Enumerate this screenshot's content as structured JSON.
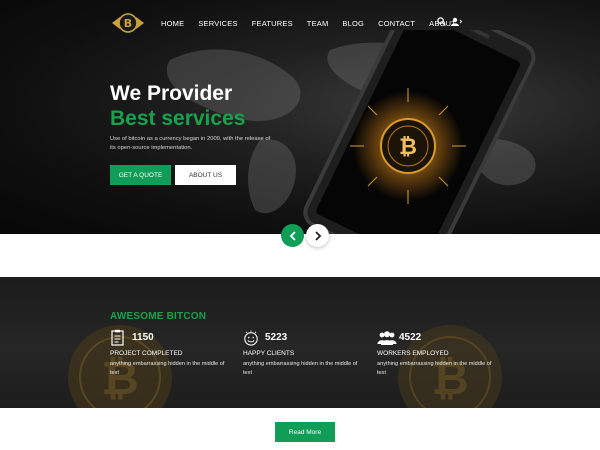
{
  "nav": {
    "items": [
      "HOME",
      "SERVICES",
      "FEATURES",
      "TEAM",
      "BLOG",
      "CONTACT",
      "ABOUT"
    ],
    "icons": [
      "search-icon",
      "user-icon"
    ]
  },
  "hero": {
    "title_line1": "We Provider",
    "title_line2": "Best services",
    "description": "Use of bitcoin as a currency began in 2009, with the release of its open-source implementation.",
    "primary_button": "GET A QUOTE",
    "secondary_button": "ABOUT US"
  },
  "stats": {
    "heading": "AWESOME BITCON",
    "items": [
      {
        "number": "1150",
        "label": "PROJECT COMPLETED",
        "desc": "anything embarrassing hidden in the middle of text",
        "icon": "clipboard-icon"
      },
      {
        "number": "5223",
        "label": "HAPPY CLIENTS",
        "desc": "anything embarrassing hidden in the middle of text",
        "icon": "smiley-icon"
      },
      {
        "number": "4522",
        "label": "WORKERS EMPLOYED",
        "desc": "anything embarrassing hidden in the middle of text",
        "icon": "group-icon"
      }
    ]
  },
  "read_more": "Read More",
  "colors": {
    "accent": "#0f9d58",
    "heading_green": "#16a34a",
    "hero_bg": "#0f0f0f",
    "stats_bg": "#222222"
  }
}
